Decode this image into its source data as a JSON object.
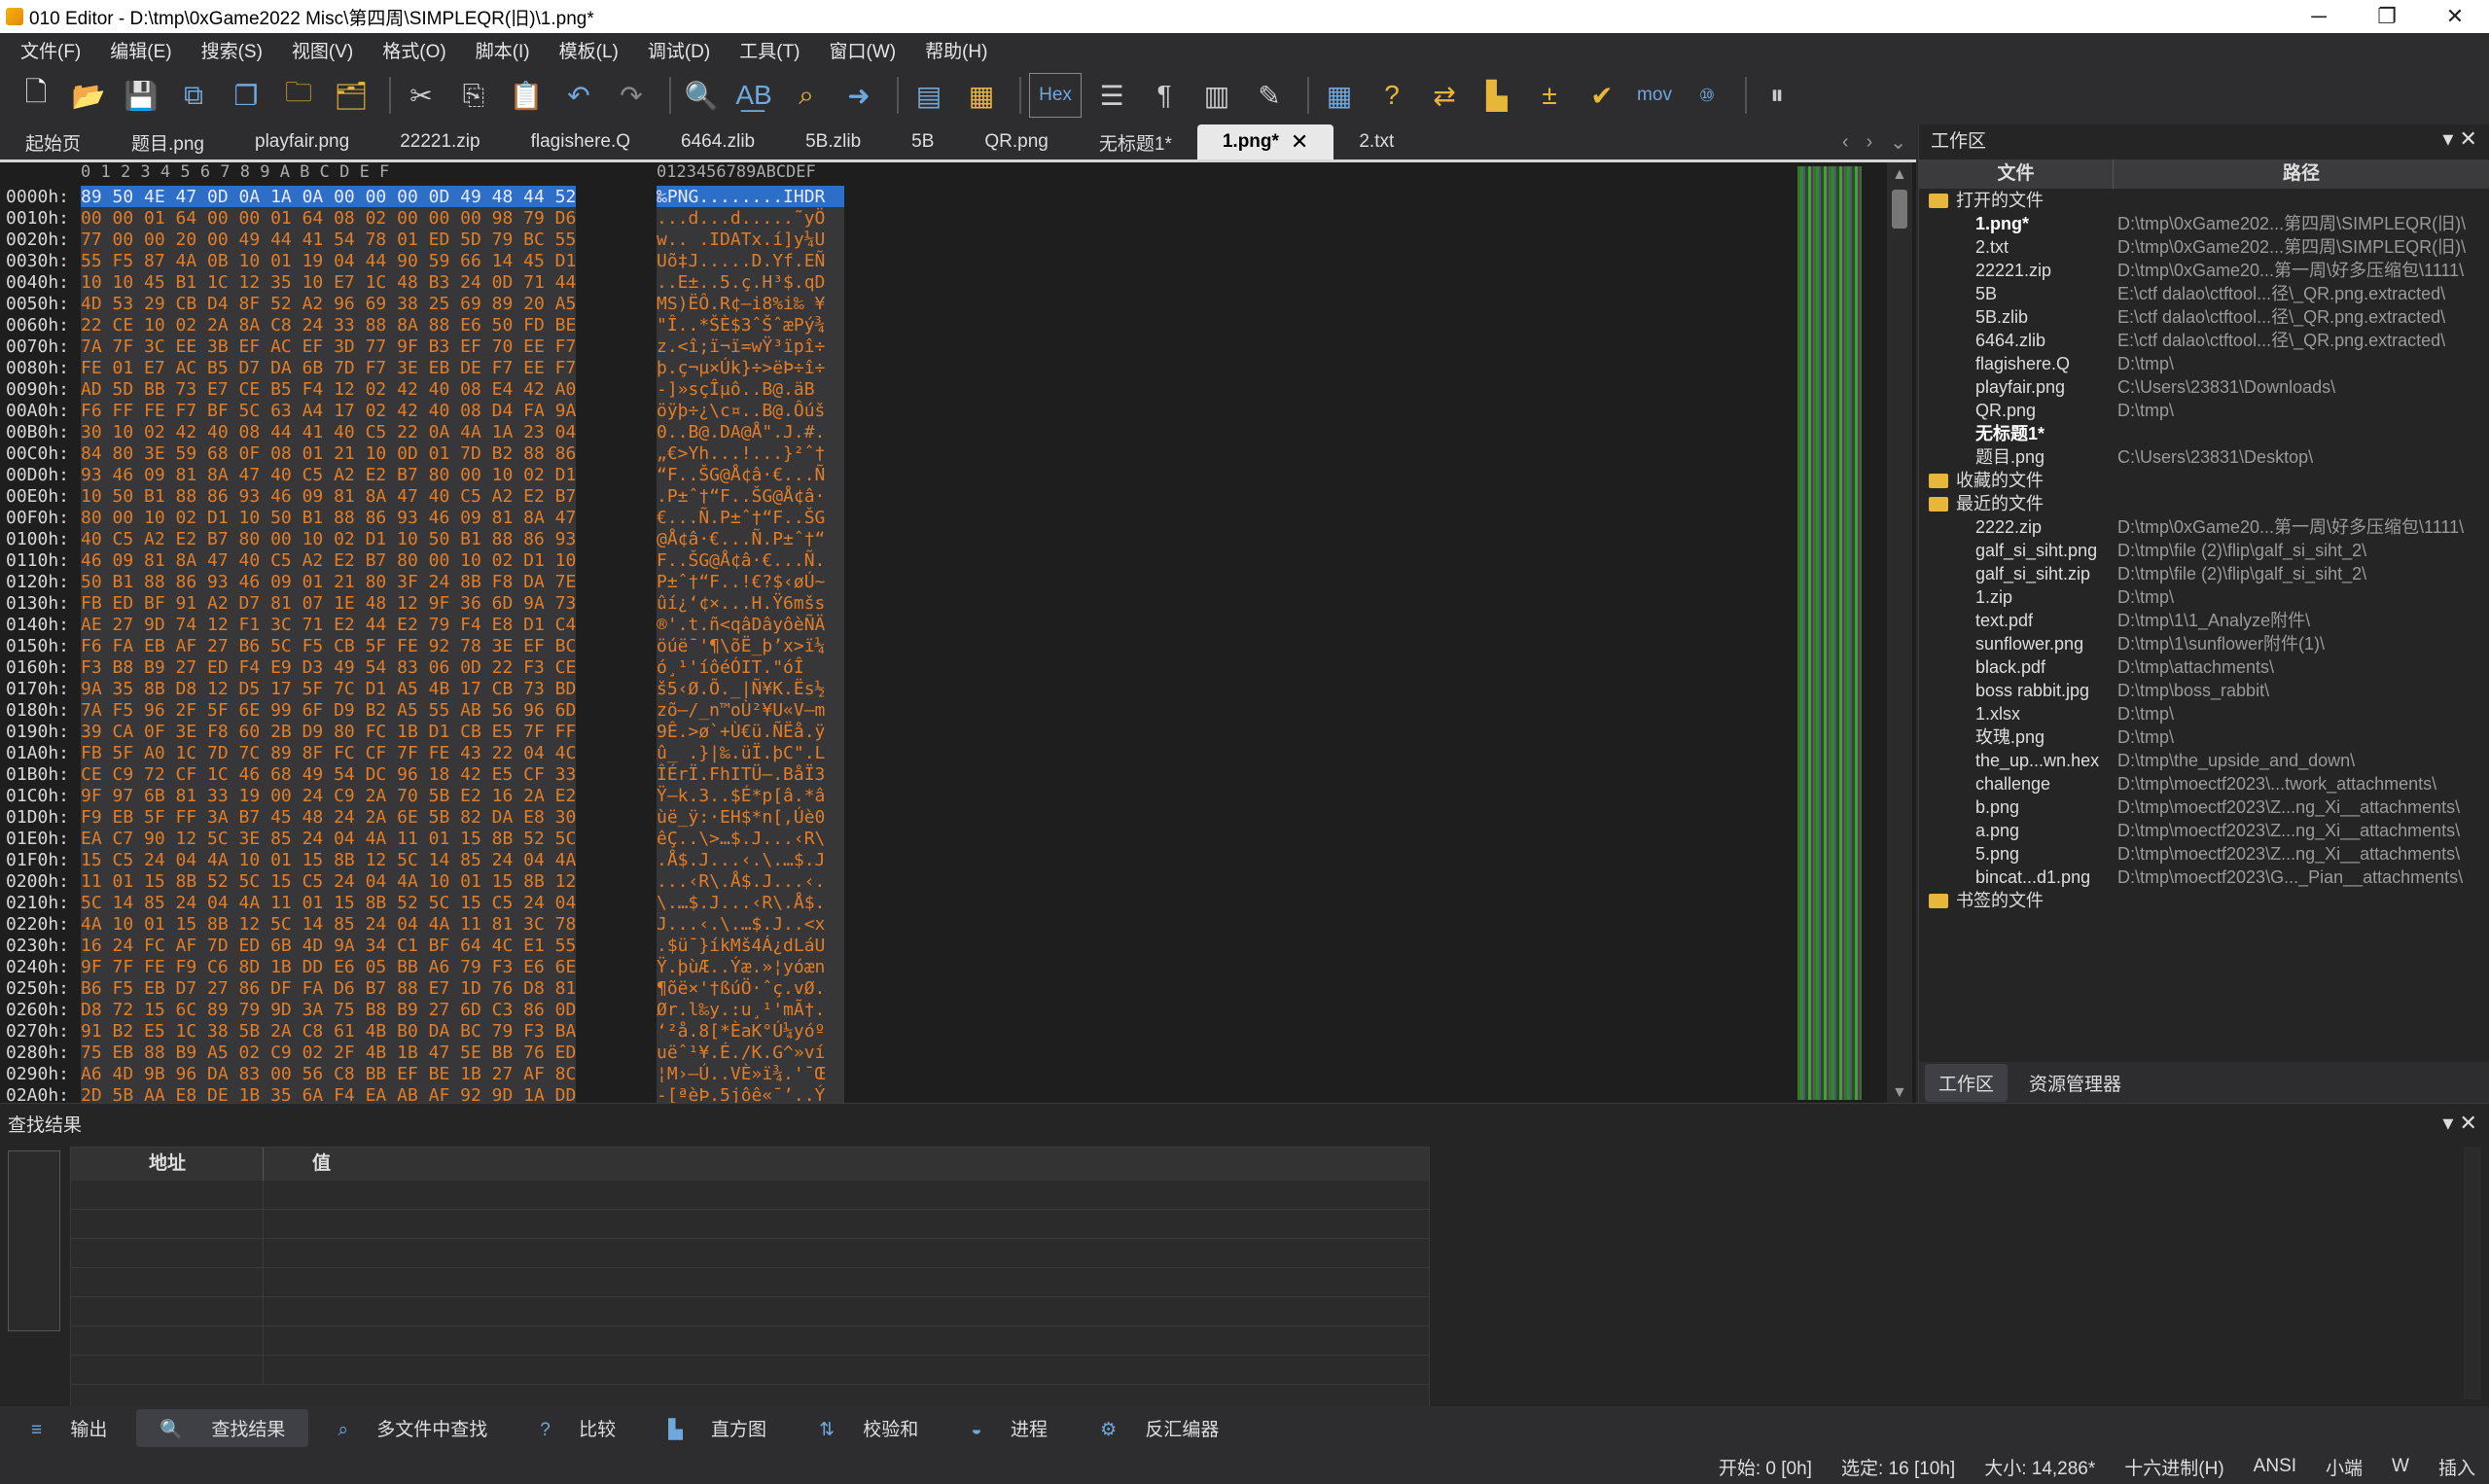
{
  "window": {
    "title": "010 Editor - D:\\tmp\\0xGame2022 Misc\\第四周\\SIMPLEQR(旧)\\1.png*",
    "minimize": "─",
    "maximize": "❐",
    "close": "✕"
  },
  "menu": [
    "文件(F)",
    "编辑(E)",
    "搜索(S)",
    "视图(V)",
    "格式(O)",
    "脚本(I)",
    "模板(L)",
    "调试(D)",
    "工具(T)",
    "窗口(W)",
    "帮助(H)"
  ],
  "toolbar": {
    "icons": [
      "new-file-icon",
      "open-icon",
      "save-icon",
      "save-as-icon",
      "save-all-icon",
      "open-folder-icon",
      "open-multiple-icon",
      "cut-icon",
      "copy-icon",
      "paste-icon",
      "undo-icon",
      "redo-icon",
      "find-icon",
      "replace-icon",
      "find-in-files-icon",
      "goto-icon",
      "run-script-icon",
      "run-template-icon",
      "hex-toggle-icon",
      "columns-icon",
      "pilcrow-icon",
      "split-icon",
      "highlight-icon",
      "calculator-icon",
      "inspector-icon",
      "compare-icon",
      "histogram-icon",
      "operations-icon",
      "checksum-icon",
      "mov-icon",
      "base-convert-icon",
      "pause-icon"
    ],
    "hex_label": "Hex",
    "mov_label": "mov"
  },
  "tabs": [
    {
      "label": "起始页",
      "active": false
    },
    {
      "label": "题目.png",
      "active": false
    },
    {
      "label": "playfair.png",
      "active": false
    },
    {
      "label": "22221.zip",
      "active": false
    },
    {
      "label": "flagishere.Q",
      "active": false
    },
    {
      "label": "6464.zlib",
      "active": false
    },
    {
      "label": "5B.zlib",
      "active": false
    },
    {
      "label": "5B",
      "active": false
    },
    {
      "label": "QR.png",
      "active": false
    },
    {
      "label": "无标题1*",
      "active": false
    },
    {
      "label": "1.png*",
      "active": true
    },
    {
      "label": "2.txt",
      "active": false
    }
  ],
  "hex": {
    "ruler_hex": " 0  1  2  3  4  5  6  7  8  9  A  B  C  D  E  F",
    "ruler_ascii": "0123456789ABCDEF",
    "rows": [
      {
        "addr": "0000h:",
        "bytes": "89 50 4E 47 0D 0A 1A 0A 00 00 00 0D 49 48 44 52",
        "ascii": "‰PNG........IHDR",
        "sel": true
      },
      {
        "addr": "0010h:",
        "bytes": "00 00 01 64 00 00 01 64 08 02 00 00 00 98 79 D6",
        "ascii": "...d...d.....˜yÖ",
        "sel": false
      },
      {
        "addr": "0020h:",
        "bytes": "77 00 00 20 00 49 44 41 54 78 01 ED 5D 79 BC 55",
        "ascii": "w.. .IDATx.í]y¼U",
        "sel": false
      },
      {
        "addr": "0030h:",
        "bytes": "55 F5 87 4A 0B 10 01 19 04 44 90 59 66 14 45 D1",
        "ascii": "Uõ‡J.....D.Yf.EÑ",
        "sel": false
      },
      {
        "addr": "0040h:",
        "bytes": "10 10 45 B1 1C 12 35 10 E7 1C 48 B3 24 0D 71 44",
        "ascii": "..E±..5.ç.H³$.qD",
        "sel": false
      },
      {
        "addr": "0050h:",
        "bytes": "4D 53 29 CB D4 8F 52 A2 96 69 38 25 69 89 20 A5",
        "ascii": "MS)ËÔ.R¢–i8%i‰ ¥",
        "sel": false
      },
      {
        "addr": "0060h:",
        "bytes": "22 CE 10 02 2A 8A C8 24 33 88 8A 88 E6 50 FD BE",
        "ascii": "\"Î..*ŠÈ$3ˆŠˆæPý¾",
        "sel": false
      },
      {
        "addr": "0070h:",
        "bytes": "7A 7F 3C EE 3B EF AC EF 3D 77 9F B3 EF 70 EE F7",
        "ascii": "z.<î;ï¬ï=wŸ³ïpî÷",
        "sel": false
      },
      {
        "addr": "0080h:",
        "bytes": "FE 01 E7 AC B5 D7 DA 6B 7D F7 3E EB DE F7 EE F7",
        "ascii": "þ.ç¬µ×Úk}÷>ëÞ÷î÷",
        "sel": false
      },
      {
        "addr": "0090h:",
        "bytes": "AD 5D BB 73 E7 CE B5 F4 12 02 42 40 08 E4 42 A0",
        "ascii": "-]»sçÎµô..B@.äB ",
        "sel": false
      },
      {
        "addr": "00A0h:",
        "bytes": "F6 FF FE F7 BF 5C 63 A4 17 02 42 40 08 D4 FA 9A",
        "ascii": "öÿþ÷¿\\c¤..B@.Ôúš",
        "sel": false
      },
      {
        "addr": "00B0h:",
        "bytes": "30 10 02 42 40 08 44 41 40 C5 22 0A 4A 1A 23 04",
        "ascii": "0..B@.DA@Å\".J.#.",
        "sel": false
      },
      {
        "addr": "00C0h:",
        "bytes": "84 80 3E 59 68 0F 08 01 21 10 0D 01 7D B2 88 86",
        "ascii": "„€>Yh...!...}²ˆ†",
        "sel": false
      },
      {
        "addr": "00D0h:",
        "bytes": "93 46 09 81 8A 47 40 C5 A2 E2 B7 80 00 10 02 D1",
        "ascii": "“F..ŠG@Å¢â·€...Ñ",
        "sel": false
      },
      {
        "addr": "00E0h:",
        "bytes": "10 50 B1 88 86 93 46 09 81 8A 47 40 C5 A2 E2 B7",
        "ascii": ".P±ˆ†“F..ŠG@Å¢â·",
        "sel": false
      },
      {
        "addr": "00F0h:",
        "bytes": "80 00 10 02 D1 10 50 B1 88 86 93 46 09 81 8A 47",
        "ascii": "€...Ñ.P±ˆ†“F..ŠG",
        "sel": false
      },
      {
        "addr": "0100h:",
        "bytes": "40 C5 A2 E2 B7 80 00 10 02 D1 10 50 B1 88 86 93",
        "ascii": "@Å¢â·€...Ñ.P±ˆ†“",
        "sel": false
      },
      {
        "addr": "0110h:",
        "bytes": "46 09 81 8A 47 40 C5 A2 E2 B7 80 00 10 02 D1 10",
        "ascii": "F..ŠG@Å¢â·€...Ñ.",
        "sel": false
      },
      {
        "addr": "0120h:",
        "bytes": "50 B1 88 86 93 46 09 01 21 80 3F 24 8B F8 DA 7E",
        "ascii": "P±ˆ†“F..!€?$‹øÚ~",
        "sel": false
      },
      {
        "addr": "0130h:",
        "bytes": "FB ED BF 91 A2 D7 81 07 1E 48 12 9F 36 6D 9A 73",
        "ascii": "ûí¿‘¢×...H.Ÿ6mšs",
        "sel": false
      },
      {
        "addr": "0140h:",
        "bytes": "AE 27 9D 74 12 F1 3C 71 E2 44 E2 79 F4 E8 D1 C4",
        "ascii": "®'.t.ñ<qâDâyôèÑÄ",
        "sel": false
      },
      {
        "addr": "0150h:",
        "bytes": "F6 FA EB AF 27 B6 5C F5 CB 5F FE 92 78 3E EF BC",
        "ascii": "öúë¯'¶\\õË_þ’x>ï¼",
        "sel": false
      },
      {
        "addr": "0160h:",
        "bytes": "F3 B8 B9 27 ED F4 E9 D3 49 54 83 06 0D 22 F3 CE",
        "ascii": "ó¸¹'íôéÓIT.\"óÎ",
        "sel": false
      },
      {
        "addr": "0170h:",
        "bytes": "9A 35 8B D8 12 D5 17 5F 7C D1 A5 4B 17 CB 73 BD",
        "ascii": "š5‹Ø.Õ._|Ñ¥K.Ës½",
        "sel": false
      },
      {
        "addr": "0180h:",
        "bytes": "7A F5 96 2F 5F 6E 99 6F D9 B2 A5 55 AB 56 96 6D",
        "ascii": "zõ–/_n™oÙ²¥U«V–m",
        "sel": false
      },
      {
        "addr": "0190h:",
        "bytes": "39 CA 0F 3E F8 60 2B D9 80 FC 1B D1 CB E5 7F FF",
        "ascii": "9Ê.>ø`+Ù€ü.ÑËå.ÿ",
        "sel": false
      },
      {
        "addr": "01A0h:",
        "bytes": "FB 5F A0 1C 7D 7C 89 8F FC CF 7F FE 43 22 04 4C",
        "ascii": "û_ .}|‰.üÏ.þC\".L",
        "sel": false
      },
      {
        "addr": "01B0h:",
        "bytes": "CE C9 72 CF 1C 46 68 49 54 DC 96 18 42 E5 CF 33",
        "ascii": "ÎÉrÏ.FhITÜ–.BåÏ3",
        "sel": false
      },
      {
        "addr": "01C0h:",
        "bytes": "9F 97 6B 81 33 19 00 24 C9 2A 70 5B E2 16 2A E2",
        "ascii": "Ÿ—k.3..$É*p[â.*â",
        "sel": false
      },
      {
        "addr": "01D0h:",
        "bytes": "F9 EB 5F FF 3A B7 45 48 24 2A 6E 5B 82 DA E8 30",
        "ascii": "ùë_ÿ:·EH$*n[‚Úè0",
        "sel": false
      },
      {
        "addr": "01E0h:",
        "bytes": "EA C7 90 12 5C 3E 85 24 04 4A 11 01 15 8B 52 5C",
        "ascii": "êÇ..\\>…$.J...‹R\\",
        "sel": false
      },
      {
        "addr": "01F0h:",
        "bytes": "15 C5 24 04 4A 10 01 15 8B 12 5C 14 85 24 04 4A",
        "ascii": ".Å$.J...‹.\\.…$.J",
        "sel": false
      },
      {
        "addr": "0200h:",
        "bytes": "11 01 15 8B 52 5C 15 C5 24 04 4A 10 01 15 8B 12",
        "ascii": "...‹R\\.Å$.J...‹.",
        "sel": false
      },
      {
        "addr": "0210h:",
        "bytes": "5C 14 85 24 04 4A 11 01 15 8B 52 5C 15 C5 24 04",
        "ascii": "\\.…$.J...‹R\\.Å$.",
        "sel": false
      },
      {
        "addr": "0220h:",
        "bytes": "4A 10 01 15 8B 12 5C 14 85 24 04 4A 11 81 3C 78",
        "ascii": "J...‹.\\.…$.J..<x",
        "sel": false
      },
      {
        "addr": "0230h:",
        "bytes": "16 24 FC AF 7D ED 6B 4D 9A 34 C1 BF 64 4C E1 55",
        "ascii": ".$ü¯}íkMš4Á¿dLáU",
        "sel": false
      },
      {
        "addr": "0240h:",
        "bytes": "9F 7F FE F9 C6 8D 1B DD E6 05 BB A6 79 F3 E6 6E",
        "ascii": "Ÿ.þùÆ..Ýæ.»¦yóæn",
        "sel": false
      },
      {
        "addr": "0250h:",
        "bytes": "B6 F5 EB D7 27 86 DF FA D6 B7 88 E7 1D 76 D8 81",
        "ascii": "¶õë×'†ßúÖ·ˆç.vØ.",
        "sel": false
      },
      {
        "addr": "0260h:",
        "bytes": "D8 72 15 6C 89 79 9D 3A 75 B8 B9 27 6D C3 86 0D",
        "ascii": "Ør.l‰y.:u¸¹'mÃ†.",
        "sel": false
      },
      {
        "addr": "0270h:",
        "bytes": "91 B2 E5 1C 38 5B 2A C8 61 4B B0 DA BC 79 F3 BA",
        "ascii": "‘²å.8[*ÈaK°Ú¼yóº",
        "sel": false
      },
      {
        "addr": "0280h:",
        "bytes": "75 EB 88 B9 A5 02 C9 02 2F 4B 1B 47 5E BB 76 ED",
        "ascii": "uëˆ¹¥.É./K.G^»ví",
        "sel": false
      },
      {
        "addr": "0290h:",
        "bytes": "A6 4D 9B 96 DA 83 00 56 C8 BB EF BE 1B 27 AF 8C",
        "ascii": "¦M›–Ú..VÈ»ï¾.'¯Œ",
        "sel": false
      },
      {
        "addr": "02A0h:",
        "bytes": "2D 5B AA E8 DE 1B 35 6A F4 EA AB AF 92 9D 1A DD",
        "ascii": "-[ªèÞ.5jôê«¯’..Ý",
        "sel": false
      }
    ]
  },
  "workspace": {
    "title": "工作区",
    "col_file": "文件",
    "col_path": "路径",
    "groups": [
      {
        "label": "打开的文件",
        "files": [
          {
            "name": "1.png*",
            "path": "D:\\tmp\\0xGame202...第四周\\SIMPLEQR(旧)\\",
            "bold": true
          },
          {
            "name": "2.txt",
            "path": "D:\\tmp\\0xGame202...第四周\\SIMPLEQR(旧)\\",
            "bold": false
          },
          {
            "name": "22221.zip",
            "path": "D:\\tmp\\0xGame20...第一周\\好多压缩包\\1111\\",
            "bold": false
          },
          {
            "name": "5B",
            "path": "E:\\ctf dalao\\ctftool...径\\_QR.png.extracted\\",
            "bold": false
          },
          {
            "name": "5B.zlib",
            "path": "E:\\ctf dalao\\ctftool...径\\_QR.png.extracted\\",
            "bold": false
          },
          {
            "name": "6464.zlib",
            "path": "E:\\ctf dalao\\ctftool...径\\_QR.png.extracted\\",
            "bold": false
          },
          {
            "name": "flagishere.Q",
            "path": "D:\\tmp\\",
            "bold": false
          },
          {
            "name": "playfair.png",
            "path": "C:\\Users\\23831\\Downloads\\",
            "bold": false
          },
          {
            "name": "QR.png",
            "path": "D:\\tmp\\",
            "bold": false
          },
          {
            "name": "无标题1*",
            "path": "",
            "bold": true
          },
          {
            "name": "题目.png",
            "path": "C:\\Users\\23831\\Desktop\\",
            "bold": false
          }
        ]
      },
      {
        "label": "收藏的文件",
        "files": []
      },
      {
        "label": "最近的文件",
        "files": [
          {
            "name": "2222.zip",
            "path": "D:\\tmp\\0xGame20...第一周\\好多压缩包\\1111\\",
            "bold": false
          },
          {
            "name": "galf_si_siht.png",
            "path": "D:\\tmp\\file (2)\\flip\\galf_si_siht_2\\",
            "bold": false
          },
          {
            "name": "galf_si_siht.zip",
            "path": "D:\\tmp\\file (2)\\flip\\galf_si_siht_2\\",
            "bold": false
          },
          {
            "name": "1.zip",
            "path": "D:\\tmp\\",
            "bold": false
          },
          {
            "name": "text.pdf",
            "path": "D:\\tmp\\1\\1_Analyze附件\\",
            "bold": false
          },
          {
            "name": "sunflower.png",
            "path": "D:\\tmp\\1\\sunflower附件(1)\\",
            "bold": false
          },
          {
            "name": "black.pdf",
            "path": "D:\\tmp\\attachments\\",
            "bold": false
          },
          {
            "name": "boss rabbit.jpg",
            "path": "D:\\tmp\\boss_rabbit\\",
            "bold": false
          },
          {
            "name": "1.xlsx",
            "path": "D:\\tmp\\",
            "bold": false
          },
          {
            "name": "玫瑰.png",
            "path": "D:\\tmp\\",
            "bold": false
          },
          {
            "name": "the_up...wn.hex",
            "path": "D:\\tmp\\the_upside_and_down\\",
            "bold": false
          },
          {
            "name": "challenge",
            "path": "D:\\tmp\\moectf2023\\...twork_attachments\\",
            "bold": false
          },
          {
            "name": "b.png",
            "path": "D:\\tmp\\moectf2023\\Z...ng_Xi__attachments\\",
            "bold": false
          },
          {
            "name": "a.png",
            "path": "D:\\tmp\\moectf2023\\Z...ng_Xi__attachments\\",
            "bold": false
          },
          {
            "name": "5.png",
            "path": "D:\\tmp\\moectf2023\\Z...ng_Xi__attachments\\",
            "bold": false
          },
          {
            "name": "bincat...d1.png",
            "path": "D:\\tmp\\moectf2023\\G..._Pian__attachments\\",
            "bold": false
          }
        ]
      },
      {
        "label": "书签的文件",
        "files": []
      }
    ],
    "tab_workspace": "工作区",
    "tab_explorer": "资源管理器"
  },
  "find": {
    "title": "查找结果",
    "col_addr": "地址",
    "col_value": "值"
  },
  "bottom_tabs": [
    "输出",
    "查找结果",
    "多文件中查找",
    "比较",
    "直方图",
    "校验和",
    "进程",
    "反汇编器"
  ],
  "status": {
    "start": "开始: 0 [0h]",
    "selected": "选定: 16 [10h]",
    "size": "大小: 14,286*",
    "mode": "十六进制(H)",
    "encoding": "ANSI",
    "endian": "小端",
    "w": "W",
    "insert": "插入"
  }
}
